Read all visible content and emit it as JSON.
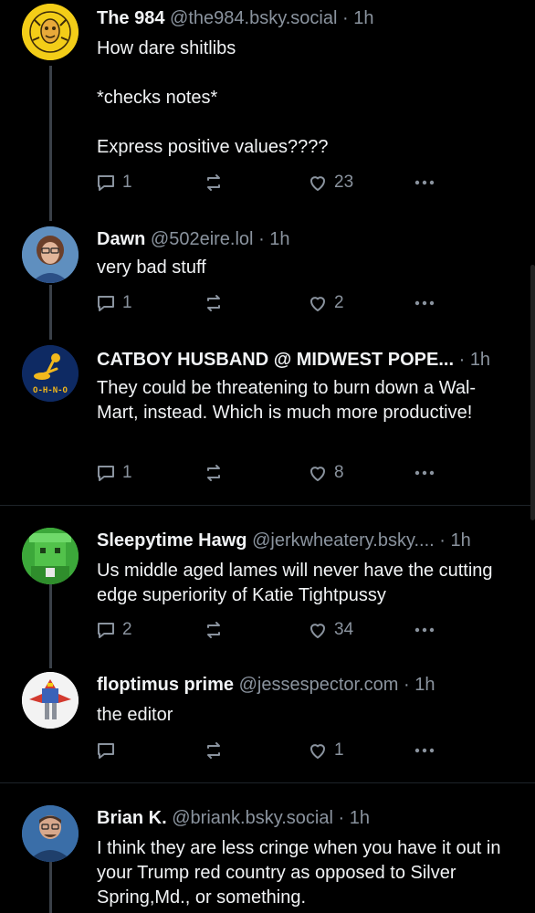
{
  "posts": [
    {
      "name": "The 984",
      "handle": "@the984.bsky.social",
      "sep": "·",
      "time": "1h",
      "text": "How dare shitlibs\n\n*checks notes*\n\nExpress positive values????",
      "replies": "1",
      "reposts": "",
      "likes": "23"
    },
    {
      "name": "Dawn",
      "handle": "@502eire.lol",
      "sep": "·",
      "time": "1h",
      "text": "very bad stuff",
      "replies": "1",
      "reposts": "",
      "likes": "2"
    },
    {
      "name": "CATBOY HUSBAND @ MIDWEST POPE...",
      "handle": "",
      "sep": "·",
      "time": "1h",
      "avatar_text": "O-H-N-O",
      "text": "They could be threatening to burn down a Wal-Mart, instead. Which is much more productive!",
      "replies": "1",
      "reposts": "",
      "likes": "8"
    },
    {
      "name": "Sleepytime Hawg",
      "handle": "@jerkwheatery.bsky....",
      "sep": "·",
      "time": "1h",
      "text": "Us middle aged lames will never have the cutting edge superiority of Katie Tightpussy",
      "replies": "2",
      "reposts": "",
      "likes": "34"
    },
    {
      "name": "floptimus prime",
      "handle": "@jessespector.com",
      "sep": "·",
      "time": "1h",
      "text": "the editor",
      "replies": "",
      "reposts": "",
      "likes": "1"
    },
    {
      "name": "Brian K.",
      "handle": "@briank.bsky.social",
      "sep": "·",
      "time": "1h",
      "text": "I think they are less cringe when you have it out in your Trump red country as opposed to Silver Spring,Md., or something.",
      "replies": "",
      "reposts": "",
      "likes": ""
    }
  ],
  "colors": {
    "background": "#000000",
    "text": "#f1f3f5",
    "muted": "#8a939e",
    "thread_line": "#3a4048"
  },
  "icons": {
    "reply": "speech-bubble-icon",
    "repost": "repost-arrows-icon",
    "like": "heart-icon",
    "more": "ellipsis-icon"
  }
}
